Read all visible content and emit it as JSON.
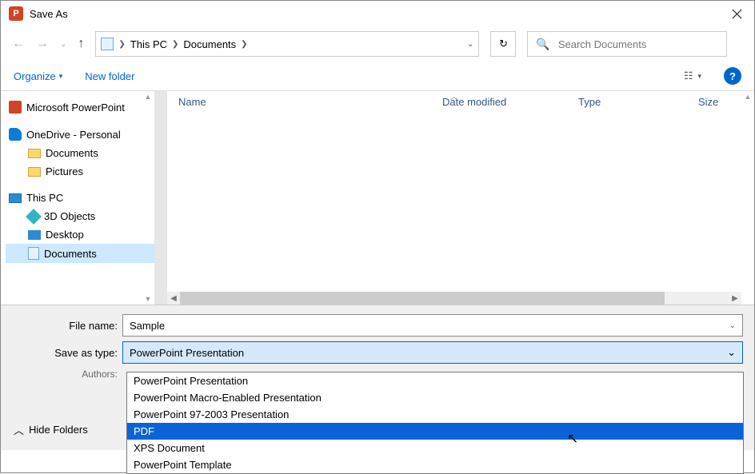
{
  "title": "Save As",
  "breadcrumb": {
    "loc1": "This PC",
    "loc2": "Documents"
  },
  "search": {
    "placeholder": "Search Documents"
  },
  "toolbar": {
    "organize": "Organize",
    "new_folder": "New folder",
    "help": "?"
  },
  "columns": {
    "name": "Name",
    "date": "Date modified",
    "type": "Type",
    "size": "Size"
  },
  "tree": {
    "powerpoint": "Microsoft PowerPoint",
    "onedrive": "OneDrive - Personal",
    "documents": "Documents",
    "pictures": "Pictures",
    "thispc": "This PC",
    "objects3d": "3D Objects",
    "desktop": "Desktop",
    "documents2": "Documents"
  },
  "form": {
    "filename_label": "File name:",
    "filename_value": "Sample",
    "type_label": "Save as type:",
    "type_value": "PowerPoint Presentation",
    "authors_label": "Authors:"
  },
  "footer": {
    "hide_folders": "Hide Folders"
  },
  "dropdown": {
    "opt0": "PowerPoint Presentation",
    "opt1": "PowerPoint Macro-Enabled Presentation",
    "opt2": "PowerPoint 97-2003 Presentation",
    "opt3": "PDF",
    "opt4": "XPS Document",
    "opt5": "PowerPoint Template"
  }
}
